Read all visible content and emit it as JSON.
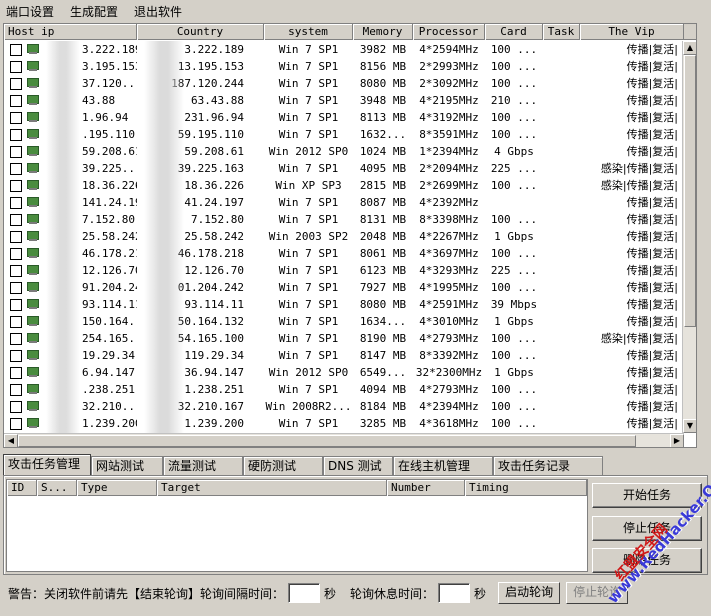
{
  "menu": [
    "端口设置",
    "生成配置",
    "退出软件"
  ],
  "grid": {
    "columns": [
      "Host ip",
      "Country",
      "system",
      "Memory",
      "Processor",
      "Card",
      "Task",
      "The Vip"
    ],
    "rows": [
      {
        "host": "3.222.189",
        "country": "3.222.189",
        "system": "Win 7 SP1",
        "memory": "3982 MB",
        "processor": "4*2594MHz",
        "card": "100 ...",
        "vip": "传播|复活|"
      },
      {
        "host": "3.195.153",
        "country": "13.195.153",
        "system": "Win 7 SP1",
        "memory": "8156 MB",
        "processor": "2*2993MHz",
        "card": "100 ...",
        "vip": "传播|复活|"
      },
      {
        "host": "37.120...",
        "country": "187.120.244",
        "system": "Win 7 SP1",
        "memory": "8080 MB",
        "processor": "2*3092MHz",
        "card": "100 ...",
        "vip": "传播|复活|"
      },
      {
        "host": "43.88",
        "country": "63.43.88",
        "system": "Win 7 SP1",
        "memory": "3948 MB",
        "processor": "4*2195MHz",
        "card": "210 ...",
        "vip": "传播|复活|"
      },
      {
        "host": "1.96.94",
        "country": "231.96.94",
        "system": "Win 7 SP1",
        "memory": "8113 MB",
        "processor": "4*3192MHz",
        "card": "100 ...",
        "vip": "传播|复活|"
      },
      {
        "host": ".195.110",
        "country": "59.195.110",
        "system": "Win 7 SP1",
        "memory": "1632...",
        "processor": "8*3591MHz",
        "card": "100 ...",
        "vip": "传播|复活|"
      },
      {
        "host": "59.208.61",
        "country": "59.208.61",
        "system": "Win 2012 SP0",
        "memory": "1024 MB",
        "processor": "1*2394MHz",
        "card": "4 Gbps",
        "vip": "传播|复活|"
      },
      {
        "host": "39.225...",
        "country": "39.225.163",
        "system": "Win 7 SP1",
        "memory": "4095 MB",
        "processor": "2*2094MHz",
        "card": "225 ...",
        "vip": "感染|传播|复活|"
      },
      {
        "host": "18.36.226",
        "country": "18.36.226",
        "system": "Win XP SP3",
        "memory": "2815 MB",
        "processor": "2*2699MHz",
        "card": "100 ...",
        "vip": "感染|传播|复活|"
      },
      {
        "host": "141.24.197",
        "country": "41.24.197",
        "system": "Win 7 SP1",
        "memory": "8087 MB",
        "processor": "4*2392MHz",
        "card": "",
        "vip": "传播|复活|"
      },
      {
        "host": "7.152.80",
        "country": "7.152.80",
        "system": "Win 7 SP1",
        "memory": "8131 MB",
        "processor": "8*3398MHz",
        "card": "100 ...",
        "vip": "传播|复活|"
      },
      {
        "host": "25.58.242",
        "country": "25.58.242",
        "system": "Win 2003 SP2",
        "memory": "2048 MB",
        "processor": "4*2267MHz",
        "card": "1 Gbps",
        "vip": "传播|复活|"
      },
      {
        "host": "46.178.218",
        "country": "46.178.218",
        "system": "Win 7 SP1",
        "memory": "8061 MB",
        "processor": "4*3697MHz",
        "card": "100 ...",
        "vip": "传播|复活|"
      },
      {
        "host": "12.126.70",
        "country": "12.126.70",
        "system": "Win 7 SP1",
        "memory": "6123 MB",
        "processor": "4*3293MHz",
        "card": "225 ...",
        "vip": "传播|复活|"
      },
      {
        "host": "91.204.242",
        "country": "01.204.242",
        "system": "Win 7 SP1",
        "memory": "7927 MB",
        "processor": "4*1995MHz",
        "card": "100 ...",
        "vip": "传播|复活|"
      },
      {
        "host": "93.114.11",
        "country": "93.114.11",
        "system": "Win 7 SP1",
        "memory": "8080 MB",
        "processor": "4*2591MHz",
        "card": "39 Mbps",
        "vip": "传播|复活|"
      },
      {
        "host": "150.164...",
        "country": "50.164.132",
        "system": "Win 7 SP1",
        "memory": "1634...",
        "processor": "4*3010MHz",
        "card": "1 Gbps",
        "vip": "传播|复活|"
      },
      {
        "host": "254.165...",
        "country": "54.165.100",
        "system": "Win 7 SP1",
        "memory": "8190 MB",
        "processor": "4*2793MHz",
        "card": "100 ...",
        "vip": "感染|传播|复活|"
      },
      {
        "host": "19.29.34",
        "country": "119.29.34",
        "system": "Win 7 SP1",
        "memory": "8147 MB",
        "processor": "8*3392MHz",
        "card": "100 ...",
        "vip": "传播|复活|"
      },
      {
        "host": "6.94.147",
        "country": "36.94.147",
        "system": "Win 2012 SP0",
        "memory": "6549...",
        "processor": "32*2300MHz",
        "card": "1 Gbps",
        "vip": "传播|复活|"
      },
      {
        "host": ".238.251",
        "country": "1.238.251",
        "system": "Win 7 SP1",
        "memory": "4094 MB",
        "processor": "4*2793MHz",
        "card": "100 ...",
        "vip": "传播|复活|"
      },
      {
        "host": "32.210...",
        "country": "32.210.167",
        "system": "Win 2008R2...",
        "memory": "8184 MB",
        "processor": "4*2394MHz",
        "card": "100 ...",
        "vip": "传播|复活|"
      },
      {
        "host": "1.239.200",
        "country": "1.239.200",
        "system": "Win 7 SP1",
        "memory": "3285 MB",
        "processor": "4*3618MHz",
        "card": "100 ...",
        "vip": "传播|复活|"
      }
    ]
  },
  "tabs": [
    "攻击任务管理",
    "网站测试",
    "流量测试",
    "硬防测试",
    "DNS 测试",
    "在线主机管理",
    "攻击任务记录"
  ],
  "task_grid": {
    "columns": [
      "ID",
      "S...",
      "Type",
      "Target",
      "Number",
      "Timing"
    ]
  },
  "buttons": {
    "start": "开始任务",
    "stop": "停止任务",
    "delete": "删除任务"
  },
  "status": {
    "warning": "警告：关闭软件前请先【结束轮询】轮询间隔时间：",
    "unit1": "秒",
    "rest_label": "轮询休息时间：",
    "unit2": "秒",
    "start_poll": "启动轮询",
    "stop_poll": "停止轮询"
  },
  "watermark": {
    "line1": "www.RedHacker.Org",
    "line2": "红盟安全网"
  },
  "colors": {
    "window_bg": "#d4d0c8",
    "watermark_blue": "#3a3ad8",
    "watermark_red": "#d01818"
  }
}
